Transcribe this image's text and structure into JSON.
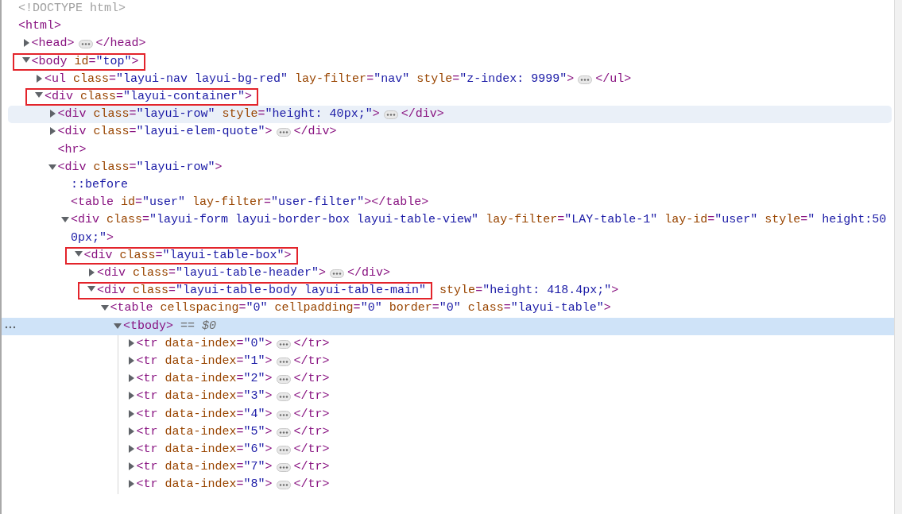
{
  "tree": [
    {
      "selected": false,
      "open": [
        {
          "kind": "doctype",
          "text": "<!DOCTYPE html>"
        }
      ]
    },
    {
      "selected": false,
      "open": [
        {
          "kind": "tag",
          "text": "<html>"
        }
      ],
      "children": [
        {
          "selected": false,
          "expanded": false,
          "open": [
            {
              "kind": "tag",
              "text": "<head>"
            }
          ],
          "close": "</head>"
        },
        {
          "selected": false,
          "expanded": true,
          "outlined": true,
          "open": [
            {
              "kind": "tag",
              "text": "<body"
            },
            {
              "kind": "attr",
              "text": " id"
            },
            {
              "kind": "tag",
              "text": "="
            },
            {
              "kind": "value",
              "text": "\"top\""
            },
            {
              "kind": "tag",
              "text": ">"
            }
          ],
          "children": [
            {
              "selected": false,
              "expanded": false,
              "open": [
                {
                  "kind": "tag",
                  "text": "<ul"
                },
                {
                  "kind": "attr",
                  "text": " class"
                },
                {
                  "kind": "tag",
                  "text": "="
                },
                {
                  "kind": "value",
                  "text": "\"layui-nav layui-bg-red\""
                },
                {
                  "kind": "attr",
                  "text": " lay-filter"
                },
                {
                  "kind": "tag",
                  "text": "="
                },
                {
                  "kind": "value",
                  "text": "\"nav\""
                },
                {
                  "kind": "attr",
                  "text": " style"
                },
                {
                  "kind": "tag",
                  "text": "="
                },
                {
                  "kind": "value",
                  "text": "\"z-index: 9999\""
                },
                {
                  "kind": "tag",
                  "text": ">"
                }
              ],
              "close": "</ul>"
            },
            {
              "selected": false,
              "expanded": true,
              "outlined": true,
              "open": [
                {
                  "kind": "tag",
                  "text": "<div"
                },
                {
                  "kind": "attr",
                  "text": " class"
                },
                {
                  "kind": "tag",
                  "text": "="
                },
                {
                  "kind": "value",
                  "text": "\"layui-container\""
                },
                {
                  "kind": "tag",
                  "text": ">"
                }
              ],
              "children": [
                {
                  "selected": false,
                  "hovered": true,
                  "expanded": false,
                  "open": [
                    {
                      "kind": "tag",
                      "text": "<div"
                    },
                    {
                      "kind": "attr",
                      "text": " class"
                    },
                    {
                      "kind": "tag",
                      "text": "="
                    },
                    {
                      "kind": "value",
                      "text": "\"layui-row\""
                    },
                    {
                      "kind": "attr",
                      "text": " style"
                    },
                    {
                      "kind": "tag",
                      "text": "="
                    },
                    {
                      "kind": "value",
                      "text": "\"height: 40px;\""
                    },
                    {
                      "kind": "tag",
                      "text": ">"
                    }
                  ],
                  "close": "</div>"
                },
                {
                  "selected": false,
                  "expanded": false,
                  "open": [
                    {
                      "kind": "tag",
                      "text": "<div"
                    },
                    {
                      "kind": "attr",
                      "text": " class"
                    },
                    {
                      "kind": "tag",
                      "text": "="
                    },
                    {
                      "kind": "value",
                      "text": "\"layui-elem-quote\""
                    },
                    {
                      "kind": "tag",
                      "text": ">"
                    }
                  ],
                  "close": "</div>"
                },
                {
                  "selected": false,
                  "open": [
                    {
                      "kind": "tag",
                      "text": "<hr>"
                    }
                  ]
                },
                {
                  "selected": false,
                  "expanded": true,
                  "open": [
                    {
                      "kind": "tag",
                      "text": "<div"
                    },
                    {
                      "kind": "attr",
                      "text": " class"
                    },
                    {
                      "kind": "tag",
                      "text": "="
                    },
                    {
                      "kind": "value",
                      "text": "\"layui-row\""
                    },
                    {
                      "kind": "tag",
                      "text": ">"
                    }
                  ],
                  "children": [
                    {
                      "selected": false,
                      "open": [
                        {
                          "kind": "pseudo",
                          "text": "::before"
                        }
                      ]
                    },
                    {
                      "selected": false,
                      "open": [
                        {
                          "kind": "tag",
                          "text": "<table"
                        },
                        {
                          "kind": "attr",
                          "text": " id"
                        },
                        {
                          "kind": "tag",
                          "text": "="
                        },
                        {
                          "kind": "value",
                          "text": "\"user\""
                        },
                        {
                          "kind": "attr",
                          "text": " lay-filter"
                        },
                        {
                          "kind": "tag",
                          "text": "="
                        },
                        {
                          "kind": "value",
                          "text": "\"user-filter\""
                        },
                        {
                          "kind": "tag",
                          "text": "></table>"
                        }
                      ]
                    },
                    {
                      "selected": false,
                      "expanded": true,
                      "open": [
                        {
                          "kind": "tag",
                          "text": "<div"
                        },
                        {
                          "kind": "attr",
                          "text": " class"
                        },
                        {
                          "kind": "tag",
                          "text": "="
                        },
                        {
                          "kind": "value",
                          "text": "\"layui-form layui-border-box layui-table-view\""
                        },
                        {
                          "kind": "attr",
                          "text": " lay-filter"
                        },
                        {
                          "kind": "tag",
                          "text": "="
                        },
                        {
                          "kind": "value",
                          "text": "\"LAY-table-1\""
                        },
                        {
                          "kind": "attr",
                          "text": " lay-id"
                        },
                        {
                          "kind": "tag",
                          "text": "="
                        },
                        {
                          "kind": "value",
                          "text": "\"user\""
                        },
                        {
                          "kind": "attr",
                          "text": " style"
                        },
                        {
                          "kind": "tag",
                          "text": "="
                        },
                        {
                          "kind": "value",
                          "text": "\" height:500px;\""
                        },
                        {
                          "kind": "tag",
                          "text": ">"
                        }
                      ],
                      "children": [
                        {
                          "selected": false,
                          "expanded": true,
                          "outlined": true,
                          "open": [
                            {
                              "kind": "tag",
                              "text": "<div"
                            },
                            {
                              "kind": "attr",
                              "text": " class"
                            },
                            {
                              "kind": "tag",
                              "text": "="
                            },
                            {
                              "kind": "value",
                              "text": "\"layui-table-box\""
                            },
                            {
                              "kind": "tag",
                              "text": ">"
                            }
                          ],
                          "children": [
                            {
                              "selected": false,
                              "expanded": false,
                              "open": [
                                {
                                  "kind": "tag",
                                  "text": "<div"
                                },
                                {
                                  "kind": "attr",
                                  "text": " class"
                                },
                                {
                                  "kind": "tag",
                                  "text": "="
                                },
                                {
                                  "kind": "value",
                                  "text": "\"layui-table-header\""
                                },
                                {
                                  "kind": "tag",
                                  "text": ">"
                                }
                              ],
                              "close": "</div>"
                            },
                            {
                              "selected": false,
                              "expanded": true,
                              "outlined": true,
                              "open": [
                                {
                                  "kind": "tag",
                                  "text": "<div"
                                },
                                {
                                  "kind": "attr",
                                  "text": " class"
                                },
                                {
                                  "kind": "tag",
                                  "text": "="
                                },
                                {
                                  "kind": "value",
                                  "text": "\"layui-table-body layui-table-main\""
                                }
                              ],
                              "after": [
                                {
                                  "kind": "attr",
                                  "text": " style"
                                },
                                {
                                  "kind": "tag",
                                  "text": "="
                                },
                                {
                                  "kind": "value",
                                  "text": "\"height: 418.4px;\""
                                },
                                {
                                  "kind": "tag",
                                  "text": ">"
                                }
                              ],
                              "children": [
                                {
                                  "selected": false,
                                  "expanded": true,
                                  "open": [
                                    {
                                      "kind": "tag",
                                      "text": "<table"
                                    },
                                    {
                                      "kind": "attr",
                                      "text": " cellspacing"
                                    },
                                    {
                                      "kind": "tag",
                                      "text": "="
                                    },
                                    {
                                      "kind": "value",
                                      "text": "\"0\""
                                    },
                                    {
                                      "kind": "attr",
                                      "text": " cellpadding"
                                    },
                                    {
                                      "kind": "tag",
                                      "text": "="
                                    },
                                    {
                                      "kind": "value",
                                      "text": "\"0\""
                                    },
                                    {
                                      "kind": "attr",
                                      "text": " border"
                                    },
                                    {
                                      "kind": "tag",
                                      "text": "="
                                    },
                                    {
                                      "kind": "value",
                                      "text": "\"0\""
                                    },
                                    {
                                      "kind": "attr",
                                      "text": " class"
                                    },
                                    {
                                      "kind": "tag",
                                      "text": "="
                                    },
                                    {
                                      "kind": "value",
                                      "text": "\"layui-table\""
                                    },
                                    {
                                      "kind": "tag",
                                      "text": ">"
                                    }
                                  ],
                                  "children": [
                                    {
                                      "selected": true,
                                      "expanded": true,
                                      "open": [
                                        {
                                          "kind": "tag",
                                          "text": "<tbody>"
                                        },
                                        {
                                          "kind": "ref",
                                          "text": " == $0"
                                        }
                                      ],
                                      "children": [
                                        {
                                          "selected": false,
                                          "expanded": false,
                                          "open": [
                                            {
                                              "kind": "tag",
                                              "text": "<tr"
                                            },
                                            {
                                              "kind": "attr",
                                              "text": " data-index"
                                            },
                                            {
                                              "kind": "tag",
                                              "text": "="
                                            },
                                            {
                                              "kind": "value",
                                              "text": "\"0\""
                                            },
                                            {
                                              "kind": "tag",
                                              "text": ">"
                                            }
                                          ],
                                          "close": "</tr>"
                                        },
                                        {
                                          "selected": false,
                                          "expanded": false,
                                          "open": [
                                            {
                                              "kind": "tag",
                                              "text": "<tr"
                                            },
                                            {
                                              "kind": "attr",
                                              "text": " data-index"
                                            },
                                            {
                                              "kind": "tag",
                                              "text": "="
                                            },
                                            {
                                              "kind": "value",
                                              "text": "\"1\""
                                            },
                                            {
                                              "kind": "tag",
                                              "text": ">"
                                            }
                                          ],
                                          "close": "</tr>"
                                        },
                                        {
                                          "selected": false,
                                          "expanded": false,
                                          "open": [
                                            {
                                              "kind": "tag",
                                              "text": "<tr"
                                            },
                                            {
                                              "kind": "attr",
                                              "text": " data-index"
                                            },
                                            {
                                              "kind": "tag",
                                              "text": "="
                                            },
                                            {
                                              "kind": "value",
                                              "text": "\"2\""
                                            },
                                            {
                                              "kind": "tag",
                                              "text": ">"
                                            }
                                          ],
                                          "close": "</tr>"
                                        },
                                        {
                                          "selected": false,
                                          "expanded": false,
                                          "open": [
                                            {
                                              "kind": "tag",
                                              "text": "<tr"
                                            },
                                            {
                                              "kind": "attr",
                                              "text": " data-index"
                                            },
                                            {
                                              "kind": "tag",
                                              "text": "="
                                            },
                                            {
                                              "kind": "value",
                                              "text": "\"3\""
                                            },
                                            {
                                              "kind": "tag",
                                              "text": ">"
                                            }
                                          ],
                                          "close": "</tr>"
                                        },
                                        {
                                          "selected": false,
                                          "expanded": false,
                                          "open": [
                                            {
                                              "kind": "tag",
                                              "text": "<tr"
                                            },
                                            {
                                              "kind": "attr",
                                              "text": " data-index"
                                            },
                                            {
                                              "kind": "tag",
                                              "text": "="
                                            },
                                            {
                                              "kind": "value",
                                              "text": "\"4\""
                                            },
                                            {
                                              "kind": "tag",
                                              "text": ">"
                                            }
                                          ],
                                          "close": "</tr>"
                                        },
                                        {
                                          "selected": false,
                                          "expanded": false,
                                          "open": [
                                            {
                                              "kind": "tag",
                                              "text": "<tr"
                                            },
                                            {
                                              "kind": "attr",
                                              "text": " data-index"
                                            },
                                            {
                                              "kind": "tag",
                                              "text": "="
                                            },
                                            {
                                              "kind": "value",
                                              "text": "\"5\""
                                            },
                                            {
                                              "kind": "tag",
                                              "text": ">"
                                            }
                                          ],
                                          "close": "</tr>"
                                        },
                                        {
                                          "selected": false,
                                          "expanded": false,
                                          "open": [
                                            {
                                              "kind": "tag",
                                              "text": "<tr"
                                            },
                                            {
                                              "kind": "attr",
                                              "text": " data-index"
                                            },
                                            {
                                              "kind": "tag",
                                              "text": "="
                                            },
                                            {
                                              "kind": "value",
                                              "text": "\"6\""
                                            },
                                            {
                                              "kind": "tag",
                                              "text": ">"
                                            }
                                          ],
                                          "close": "</tr>"
                                        },
                                        {
                                          "selected": false,
                                          "expanded": false,
                                          "open": [
                                            {
                                              "kind": "tag",
                                              "text": "<tr"
                                            },
                                            {
                                              "kind": "attr",
                                              "text": " data-index"
                                            },
                                            {
                                              "kind": "tag",
                                              "text": "="
                                            },
                                            {
                                              "kind": "value",
                                              "text": "\"7\""
                                            },
                                            {
                                              "kind": "tag",
                                              "text": ">"
                                            }
                                          ],
                                          "close": "</tr>"
                                        },
                                        {
                                          "selected": false,
                                          "expanded": false,
                                          "open": [
                                            {
                                              "kind": "tag",
                                              "text": "<tr"
                                            },
                                            {
                                              "kind": "attr",
                                              "text": " data-index"
                                            },
                                            {
                                              "kind": "tag",
                                              "text": "="
                                            },
                                            {
                                              "kind": "value",
                                              "text": "\"8\""
                                            },
                                            {
                                              "kind": "tag",
                                              "text": ">"
                                            }
                                          ],
                                          "close": "</tr>"
                                        }
                                      ]
                                    }
                                  ]
                                }
                              ]
                            }
                          ]
                        }
                      ]
                    }
                  ]
                }
              ]
            }
          ]
        }
      ]
    }
  ]
}
